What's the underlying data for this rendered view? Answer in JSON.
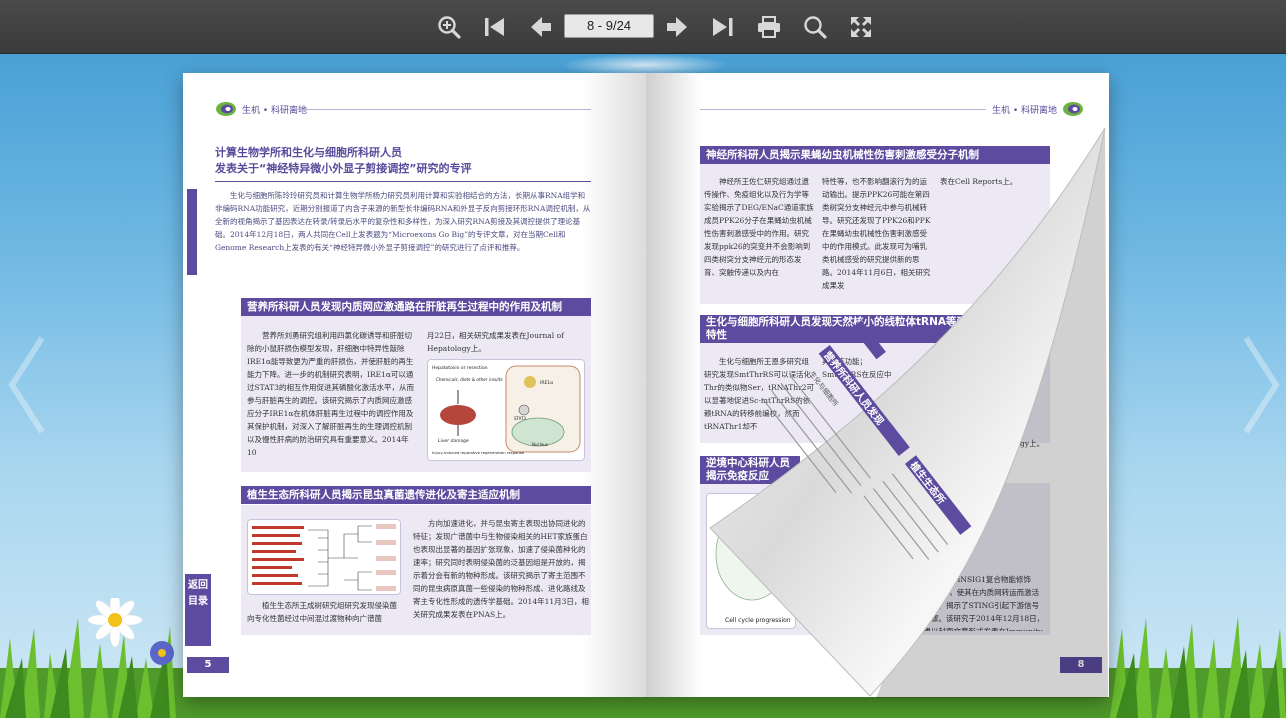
{
  "toolbar": {
    "page_indicator": "8 - 9/24",
    "buttons": [
      {
        "name": "zoom-in",
        "icon": "zoom-in-icon"
      },
      {
        "name": "first-page",
        "icon": "first-page-icon"
      },
      {
        "name": "prev-page",
        "icon": "arrow-left-icon"
      },
      {
        "name": "next-page",
        "icon": "arrow-right-icon"
      },
      {
        "name": "last-page",
        "icon": "last-page-icon"
      },
      {
        "name": "print",
        "icon": "printer-icon"
      },
      {
        "name": "search",
        "icon": "search-icon"
      },
      {
        "name": "fullscreen",
        "icon": "fullscreen-icon"
      }
    ]
  },
  "left_page": {
    "header_label": "生机 • 科研离地",
    "lead": {
      "title_line1": "计算生物学所和生化与细胞所科研人员",
      "title_line2": "发表关于“神经特异微小外显子剪接调控”研究的专评",
      "text": "生化与细胞所陈玲玲研究员和计算生物学所杨力研究员利用计算和实验相结合的方法，长期从事RNA组学和非编码RNA功能研究，近期分别报道了内含子来源的新型长非编码RNA和外显子反向剪接环形RNA调控机制，从全新的视角揭示了基因表达在转录/转录后水平的复杂性和多样性，为深入研究RNA剪接及其调控提供了理论基础。2014年12月18日，两人共同在Cell上发表题为“Microexons Go Big”的专评文章，对在当期Cell和Genome Research上发表的有关“神经特异微小外显子剪接调控”的研究进行了点评和推荐。"
    },
    "section1": {
      "title": "营养所科研人员发现内质网应激通路在肝脏再生过程中的作用及机制",
      "col1": "营养所刘勇研究组利用四氯化碳诱导和肝脏切除的小鼠肝损伤模型发现，肝细胞中特异性敲除IRE1α能导致更为严重的肝损伤，并使肝脏的再生能力下降。进一步的机制研究表明，IRE1α可以通过STAT3的相互作用促进其磷酸化激活水平，从而参与肝脏再生的调控。该研究揭示了内质网应激感应分子IRE1α在机体肝脏再生过程中的调控作用及其保护机制，对深入了解肝脏再生的生理调控机制以及慢性肝病的防治研究具有重要意义。2014年10",
      "col2": "月22日，相关研究成果发表在Journal of Hepatology上。",
      "figure_labels": [
        "Hepatotoxin or resection",
        "Chemicals, diets & other insults",
        "Liver damage",
        "Injury-induced reparative regeneration response",
        "IRE1α",
        "STAT3",
        "Nucleus"
      ]
    },
    "section2": {
      "title": "植生生态所科研人员揭示昆虫真菌遗传进化及寄主适应机制",
      "col2a": "方向加速进化，并与昆虫寄主表现出协同进化的特征；发现广谱菌中与生物侵染相关的HET家族蛋白也表现出显著的基因扩张现象，加速了侵染菌种化的速率；研究同时表明侵染菌的泛基因组是开放的，揭示着分会有新的物种形成。该研究揭示了寄主范围不同的昆虫病原真菌一些侵染的物种形成、进化路线及寄主专化性形成的遗传学基础。2014年11月3日，相关研究成果发表在PNAS上。",
      "col1": "植生生态所王成树研究组研究发现侵染菌向专化性菌经过中间混过渡物种向广谱菌"
    },
    "toc_label": "返回目录",
    "page_number": "5"
  },
  "right_page": {
    "header_label": "生机 • 科研离地",
    "section1": {
      "title": "神经所科研人员揭示果蝇幼虫机械性伤害刺激感受分子机制",
      "col1": "神经所王佐仁研究组通过遗传操作、免疫组化以及行为学等实验揭示了DEG/ENaC通道家族成员PPK26分子在果蝇幼虫机械性伤害刺激感受中的作用。研究发现ppk26的突变并不会影响到四类树突分支神经元的形态发育、突触传递以及内在",
      "col2": "特性等，也不影响翻滚行为的运动输出。提示PPK26可能在第四类树突分支神经元中参与机械转导。研究还发现了PPK26和PPK在果蝇幼虫机械性伤害刺激感受中的作用模式。此发现可为哺乳类机械感受的研究提供新的思路。2014年11月6日，相关研究成果发",
      "col3": "表在Cell Reports上。"
    },
    "section2": {
      "title": "生化与细胞所科研人员发现天然核小的线粒体tRNA等受体特异性的编校特性",
      "col1": "生化与细胞所王恩多研究组研究发现SmtThrRS可以误活化Thr的类似物Ser，tRNAThr2可以显著地促进Sc-mtThrRS的依赖tRNA的转移前编校，然而tRNAThr1却不",
      "col2": "具有该功能；SmtThrRS在反应中",
      "col3": "表在Journal of Biology上。"
    },
    "section3": {
      "title": "逆境中心科研人员揭示免疫反应",
      "col3": "与内质网蛋白AMFR/INSIG1复合物能修饰STING上的泛素化，使其在内质网转运而激活干扰素信号通路，揭示了STING引起下游信号激活的关键步骤。该研究于2014年12月18日，相关研究成果以封面文章形式发表在Immunity上，并受到了对该研究工作的专业评述。",
      "figure_label": "Cell cycle progression"
    },
    "curl_text": [
      "营养所科研人员发现",
      "植生生态所",
      "生化与细胞所"
    ],
    "page_number": "8"
  }
}
